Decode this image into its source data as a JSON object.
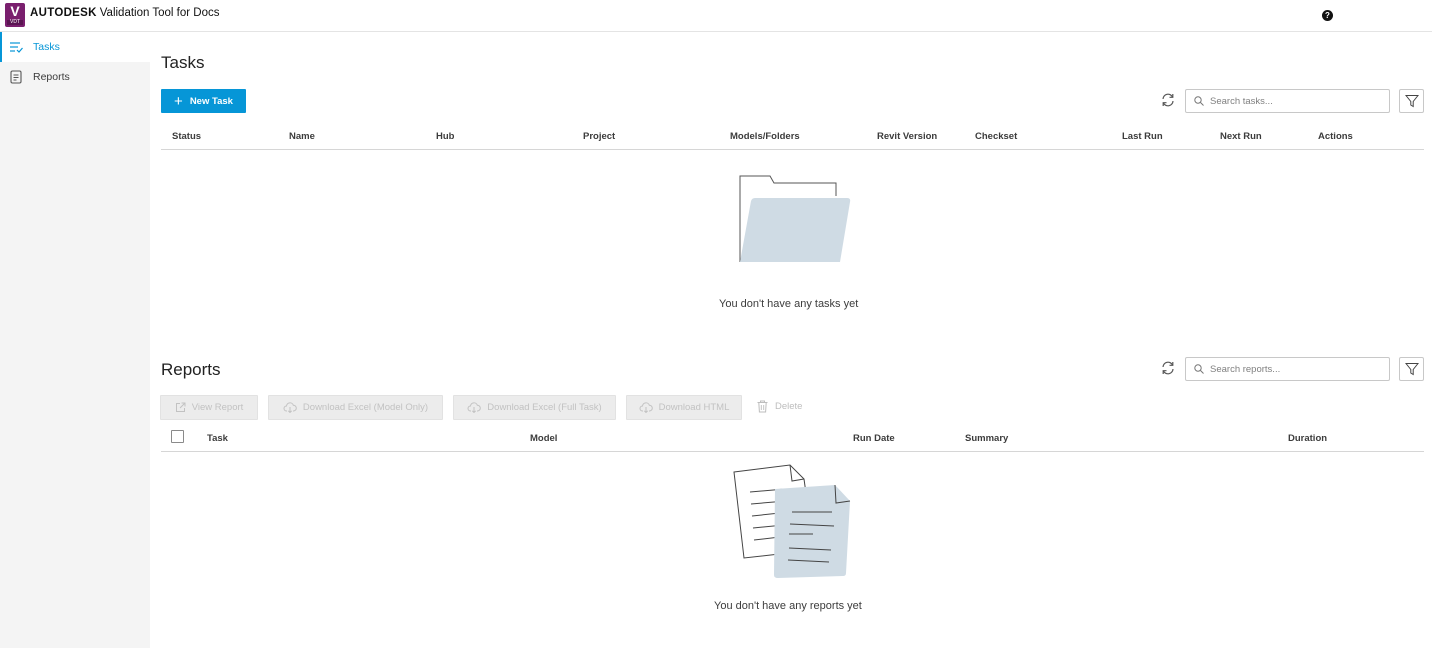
{
  "header": {
    "logo_letter": "V",
    "logo_sub": "VDT",
    "brand": "AUTODESK",
    "app_title": "Validation Tool for Docs",
    "help_glyph": "?"
  },
  "sidebar": {
    "items": [
      {
        "label": "Tasks",
        "icon": "tasks-list-icon",
        "active": true
      },
      {
        "label": "Reports",
        "icon": "report-document-icon",
        "active": false
      }
    ]
  },
  "colors": {
    "accent": "#0696d7",
    "logo": "#7a1f6e",
    "illustration": "#cfdbe4"
  },
  "tasks": {
    "title": "Tasks",
    "new_task_label": "New Task",
    "search_placeholder": "Search tasks...",
    "columns": [
      "Status",
      "Name",
      "Hub",
      "Project",
      "Models/Folders",
      "Revit Version",
      "Checkset",
      "Last Run",
      "Next Run",
      "Actions"
    ],
    "empty_message": "You don't have any tasks yet"
  },
  "reports": {
    "title": "Reports",
    "search_placeholder": "Search reports...",
    "actions": {
      "view_report": "View Report",
      "download_excel_model": "Download Excel (Model Only)",
      "download_excel_full": "Download Excel (Full Task)",
      "download_html": "Download HTML",
      "delete": "Delete"
    },
    "columns": [
      "Task",
      "Model",
      "Run Date",
      "Summary",
      "Duration"
    ],
    "empty_message": "You don't have any reports yet"
  }
}
